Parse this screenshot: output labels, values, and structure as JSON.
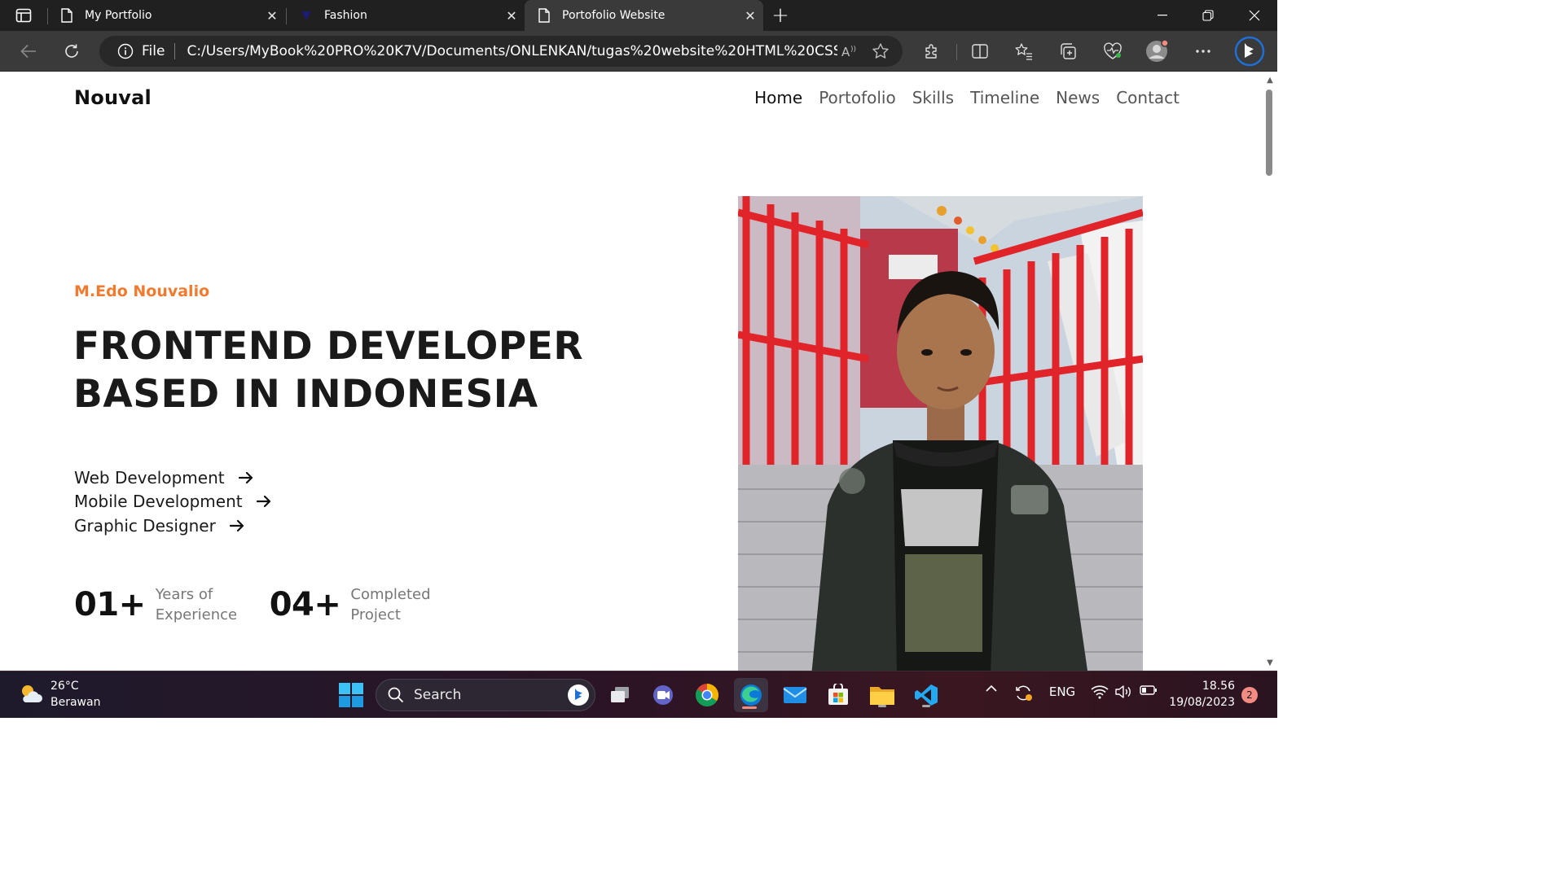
{
  "browser": {
    "tabs": [
      {
        "title": "My Portfolio",
        "active": false
      },
      {
        "title": "Fashion",
        "active": false
      },
      {
        "title": "Portofolio Website",
        "active": true
      }
    ],
    "address": {
      "scheme_label": "File",
      "url": "C:/Users/MyBook%20PRO%20K7V/Documents/ONLENKAN/tugas%20website%20HTML%20CSS%20..."
    }
  },
  "page": {
    "logo": "Nouval",
    "nav": [
      {
        "label": "Home",
        "current": true
      },
      {
        "label": "Portofolio",
        "current": false
      },
      {
        "label": "Skills",
        "current": false
      },
      {
        "label": "Timeline",
        "current": false
      },
      {
        "label": "News",
        "current": false
      },
      {
        "label": "Contact",
        "current": false
      }
    ],
    "hero": {
      "name": "M.Edo Nouvalio",
      "title_line1": "FRONTEND DEVELOPER",
      "title_line2": "BASED IN INDONESIA",
      "services": [
        "Web Development",
        "Mobile Development",
        "Graphic Designer"
      ],
      "stats": [
        {
          "number": "01+",
          "label": "Years of Experience"
        },
        {
          "number": "04+",
          "label": "Completed Project"
        }
      ]
    },
    "colors": {
      "accent": "#f07a2f",
      "text": "#111111",
      "muted": "#777777"
    }
  },
  "taskbar": {
    "weather": {
      "temp": "26°C",
      "condition": "Berawan"
    },
    "search_label": "Search",
    "language": "ENG",
    "time": "18.56",
    "date": "19/08/2023",
    "notifications": "2"
  }
}
